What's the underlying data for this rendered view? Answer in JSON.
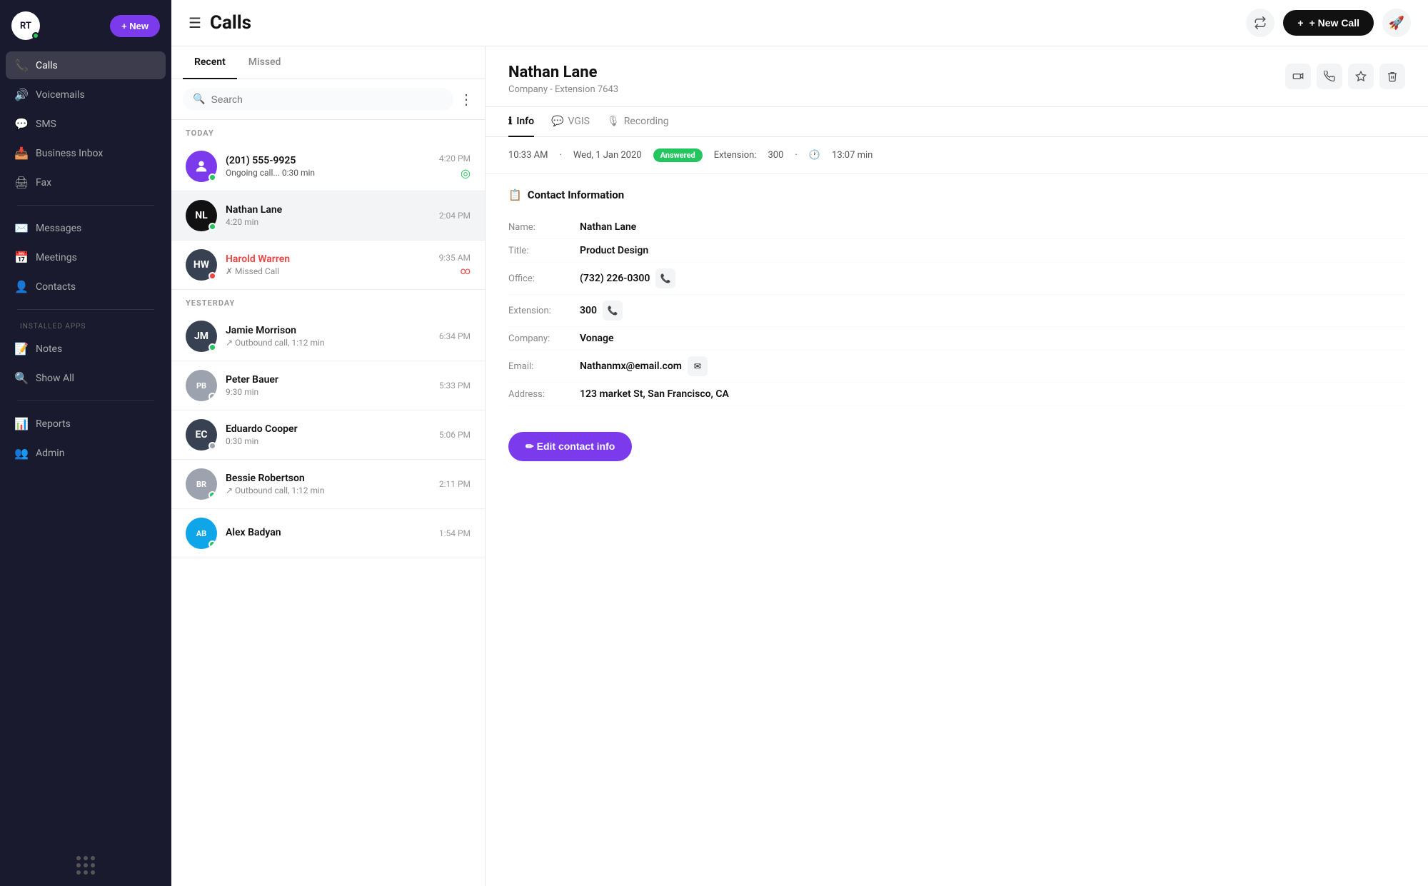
{
  "sidebar": {
    "avatar": "RT",
    "new_button": "+ New",
    "nav_items": [
      {
        "id": "calls",
        "label": "Calls",
        "icon": "📞",
        "active": true
      },
      {
        "id": "voicemails",
        "label": "Voicemails",
        "icon": "🔊",
        "active": false
      },
      {
        "id": "sms",
        "label": "SMS",
        "icon": "💬",
        "active": false
      },
      {
        "id": "business-inbox",
        "label": "Business Inbox",
        "icon": "📥",
        "active": false
      },
      {
        "id": "fax",
        "label": "Fax",
        "icon": "🖨",
        "active": false
      },
      {
        "id": "messages",
        "label": "Messages",
        "icon": "✉️",
        "active": false
      },
      {
        "id": "meetings",
        "label": "Meetings",
        "icon": "📅",
        "active": false
      },
      {
        "id": "contacts",
        "label": "Contacts",
        "icon": "👤",
        "active": false
      }
    ],
    "installed_apps_label": "INSTALLED APPS",
    "app_items": [
      {
        "id": "notes",
        "label": "Notes",
        "icon": "📝"
      },
      {
        "id": "show-all",
        "label": "Show All",
        "icon": "🔍"
      }
    ],
    "bottom_items": [
      {
        "id": "reports",
        "label": "Reports",
        "icon": "📊"
      },
      {
        "id": "admin",
        "label": "Admin",
        "icon": "👥"
      }
    ]
  },
  "topbar": {
    "page_title": "Calls",
    "new_call_button": "+ New Call"
  },
  "call_list": {
    "tabs": [
      "Recent",
      "Missed"
    ],
    "active_tab": "Recent",
    "search_placeholder": "Search",
    "sections": [
      {
        "label": "TODAY",
        "calls": [
          {
            "id": 1,
            "name": "(201) 555-9925",
            "sub": "Ongoing call... 0:30 min",
            "time": "4:20 PM",
            "avatar_bg": "#7c3aed",
            "avatar_initials": "",
            "avatar_type": "person",
            "status": "green",
            "is_missed": false,
            "is_ongoing": true,
            "has_voicemail": false
          },
          {
            "id": 2,
            "name": "Nathan Lane",
            "sub": "4:20 min",
            "time": "2:04 PM",
            "avatar_bg": "#111",
            "avatar_initials": "NL",
            "avatar_type": "initials",
            "status": "green",
            "is_missed": false,
            "is_ongoing": false,
            "has_voicemail": false,
            "selected": true
          },
          {
            "id": 3,
            "name": "Harold Warren",
            "sub": "Missed Call",
            "time": "9:35 AM",
            "avatar_bg": "#374151",
            "avatar_initials": "HW",
            "avatar_type": "initials",
            "status": "red",
            "is_missed": true,
            "is_ongoing": false,
            "has_voicemail": true
          }
        ]
      },
      {
        "label": "YESTERDAY",
        "calls": [
          {
            "id": 4,
            "name": "Jamie Morrison",
            "sub": "Outbound call, 1:12 min",
            "time": "6:34 PM",
            "avatar_bg": "#374151",
            "avatar_initials": "JM",
            "avatar_type": "initials",
            "status": "green",
            "is_missed": false,
            "is_ongoing": false,
            "has_voicemail": false,
            "outbound": true
          },
          {
            "id": 5,
            "name": "Peter Bauer",
            "sub": "9:30 min",
            "time": "5:33 PM",
            "avatar_bg": "#9ca3af",
            "avatar_initials": "PB",
            "avatar_type": "photo",
            "status": "gray",
            "is_missed": false,
            "is_ongoing": false,
            "has_voicemail": false
          },
          {
            "id": 6,
            "name": "Eduardo Cooper",
            "sub": "0:30 min",
            "time": "5:06 PM",
            "avatar_bg": "#374151",
            "avatar_initials": "EC",
            "avatar_type": "initials",
            "status": "gray",
            "is_missed": false,
            "is_ongoing": false,
            "has_voicemail": false
          },
          {
            "id": 7,
            "name": "Bessie Robertson",
            "sub": "Outbound call, 1:12 min",
            "time": "2:11 PM",
            "avatar_bg": "#9ca3af",
            "avatar_initials": "BR",
            "avatar_type": "photo",
            "status": "green",
            "is_missed": false,
            "is_ongoing": false,
            "has_voicemail": false,
            "outbound": true
          },
          {
            "id": 8,
            "name": "Alex Badyan",
            "sub": "",
            "time": "1:54 PM",
            "avatar_bg": "#0ea5e9",
            "avatar_initials": "AB",
            "avatar_type": "photo",
            "status": "green",
            "is_missed": false,
            "is_ongoing": false,
            "has_voicemail": false
          }
        ]
      }
    ]
  },
  "detail": {
    "name": "Nathan Lane",
    "subtitle": "Company  -  Extension 7643",
    "tabs": [
      {
        "id": "info",
        "label": "Info",
        "icon": "ℹ"
      },
      {
        "id": "vgis",
        "label": "VGIS",
        "icon": "💬"
      },
      {
        "id": "recording",
        "label": "Recording",
        "icon": "🎙"
      }
    ],
    "active_tab": "Info",
    "call_meta": {
      "time": "10:33 AM",
      "date": "Wed, 1 Jan 2020",
      "status": "Answered",
      "extension_label": "Extension:",
      "extension_value": "300",
      "duration_value": "13:07 min"
    },
    "contact": {
      "section_title": "Contact Information",
      "fields": [
        {
          "label": "Name:",
          "value": "Nathan Lane",
          "has_action": false
        },
        {
          "label": "Title:",
          "value": "Product  Design",
          "has_action": false
        },
        {
          "label": "Office:",
          "value": "(732) 226-0300",
          "has_action": true,
          "action_icon": "📞"
        },
        {
          "label": "Extension:",
          "value": "300",
          "has_action": true,
          "action_icon": "📞"
        },
        {
          "label": "Company:",
          "value": "Vonage",
          "has_action": false
        },
        {
          "label": "Email:",
          "value": "Nathanmx@email.com",
          "has_action": true,
          "action_icon": "✉"
        },
        {
          "label": "Address:",
          "value": "123 market St, San Francisco, CA",
          "has_action": false
        }
      ]
    },
    "edit_button": "✏  Edit contact info"
  }
}
